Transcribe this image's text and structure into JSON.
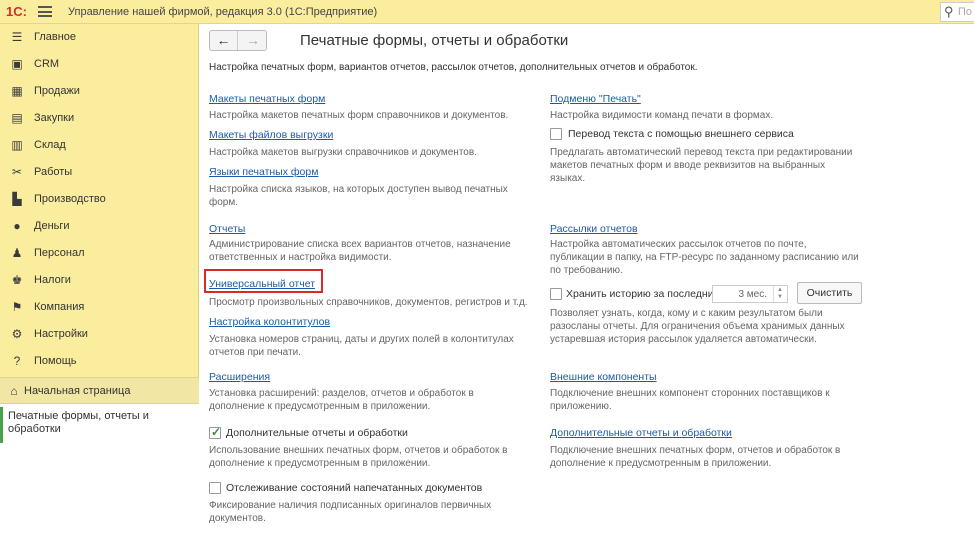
{
  "app": {
    "logo": "1С:",
    "title": "Управление нашей фирмой, редакция 3.0  (1С:Предприятие)",
    "search_placeholder": "По"
  },
  "sidebar": {
    "items": [
      {
        "label": "Главное",
        "icon": "☰"
      },
      {
        "label": "CRM",
        "icon": "▣"
      },
      {
        "label": "Продажи",
        "icon": "▦"
      },
      {
        "label": "Закупки",
        "icon": "▤"
      },
      {
        "label": "Склад",
        "icon": "▥"
      },
      {
        "label": "Работы",
        "icon": "✂"
      },
      {
        "label": "Производство",
        "icon": "▙"
      },
      {
        "label": "Деньги",
        "icon": "●"
      },
      {
        "label": "Персонал",
        "icon": "♟"
      },
      {
        "label": "Налоги",
        "icon": "♚"
      },
      {
        "label": "Компания",
        "icon": "⚑"
      },
      {
        "label": "Настройки",
        "icon": "⚙"
      },
      {
        "label": "Помощь",
        "icon": "?"
      }
    ],
    "home": {
      "label": "Начальная страница",
      "icon": "⌂"
    },
    "open_window": "Печатные формы, отчеты и обработки"
  },
  "main": {
    "back": "←",
    "forward": "→",
    "title": "Печатные формы, отчеты и обработки",
    "description": "Настройка печатных форм, вариантов отчетов, рассылок отчетов, дополнительных отчетов и обработок.",
    "left": {
      "print_layouts": {
        "link": "Макеты печатных форм",
        "desc": "Настройка макетов печатных форм справочников и документов."
      },
      "export_layouts": {
        "link": "Макеты файлов выгрузки",
        "desc": "Настройка макетов выгрузки справочников и документов."
      },
      "print_languages": {
        "link": "Языки печатных форм",
        "desc": "Настройка списка языков, на которых доступен вывод печатных форм."
      },
      "reports": {
        "link": "Отчеты",
        "desc": "Администрирование списка всех вариантов отчетов, назначение ответственных и настройка видимости."
      },
      "universal_report": {
        "link": "Универсальный отчет",
        "desc": "Просмотр произвольных справочников, документов, регистров и т.д."
      },
      "headers_footers": {
        "link": "Настройка колонтитулов",
        "desc": "Установка номеров страниц, даты и других полей в колонтитулах отчетов при печати."
      },
      "extensions": {
        "link": "Расширения",
        "desc": "Установка расширений: разделов, отчетов и обработок в дополнение к предусмотренным в приложении."
      },
      "additional_reports": {
        "label": "Дополнительные отчеты и обработки",
        "checked": true,
        "desc": "Использование внешних печатных форм, отчетов и обработок в дополнение к предусмотренным в приложении."
      },
      "print_tracking": {
        "label": "Отслеживание состояний напечатанных документов",
        "checked": false,
        "desc": "Фиксирование наличия подписанных оригиналов первичных документов."
      }
    },
    "right": {
      "print_substitute": {
        "link": "Подменю \"Печать\"",
        "desc": "Настройка видимости команд печати в формах."
      },
      "translation": {
        "label": "Перевод текста с помощью внешнего сервиса",
        "checked": false,
        "desc": "Предлагать автоматический перевод текста при редактировании макетов печатных форм и вводе реквизитов на выбранных языках."
      },
      "mailings": {
        "link": "Рассылки отчетов",
        "desc": "Настройка автоматических рассылок отчетов по почте, публикации в папку, на FTP-ресурс по заданному расписанию или по требованию."
      },
      "history": {
        "label": "Хранить историю за последние",
        "checked": false,
        "months": "3 мес.",
        "clear": "Очистить",
        "desc": "Позволяет узнать, когда, кому и с каким результатом были разосланы отчеты. Для ограничения объема хранимых данных устаревшая история рассылок удаляется автоматически."
      },
      "external_components": {
        "link": "Внешние компоненты",
        "desc": "Подключение внешних компонент сторонних поставщиков к приложению."
      },
      "additional_reports_link": {
        "link": "Дополнительные отчеты и обработки",
        "desc": "Подключение внешних печатных форм, отчетов и обработок в дополнение к предусмотренным в приложении."
      }
    }
  }
}
